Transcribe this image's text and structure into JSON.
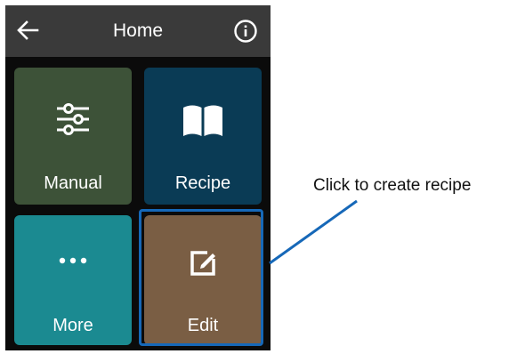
{
  "header": {
    "title": "Home",
    "back_icon": "arrow-left-icon",
    "info_icon": "info-icon"
  },
  "tiles": [
    {
      "label": "Manual",
      "icon": "sliders-icon",
      "color": "#3d5238"
    },
    {
      "label": "Recipe",
      "icon": "book-icon",
      "color": "#0a3b55"
    },
    {
      "label": "More",
      "icon": "ellipsis-icon",
      "color": "#1b8a91"
    },
    {
      "label": "Edit",
      "icon": "edit-icon",
      "color": "#7a5e44"
    }
  ],
  "annotation": {
    "text": "Click to create recipe",
    "highlight_color": "#1668b8"
  }
}
